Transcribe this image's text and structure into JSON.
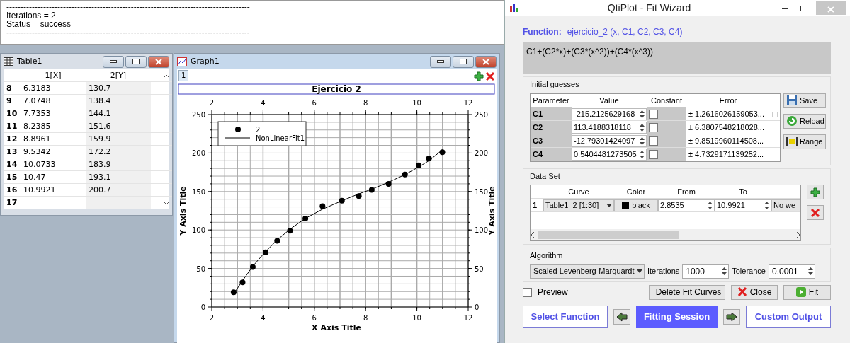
{
  "log": {
    "lines": [
      "--------------------------------------------------------------------------------------",
      "Iterations = 2",
      "Status = success",
      "--------------------------------------------------------------------------------------"
    ]
  },
  "table_window": {
    "title": "Table1",
    "columns": [
      "1[X]",
      "2[Y]"
    ],
    "rows": [
      {
        "index": "8",
        "cells": [
          "6.3183",
          "130.7"
        ]
      },
      {
        "index": "9",
        "cells": [
          "7.0748",
          "138.4"
        ]
      },
      {
        "index": "10",
        "cells": [
          "7.7353",
          "144.1"
        ]
      },
      {
        "index": "11",
        "cells": [
          "8.2385",
          "151.6"
        ]
      },
      {
        "index": "12",
        "cells": [
          "8.8961",
          "159.9"
        ]
      },
      {
        "index": "13",
        "cells": [
          "9.5342",
          "172.2"
        ]
      },
      {
        "index": "14",
        "cells": [
          "10.0733",
          "183.9"
        ]
      },
      {
        "index": "15",
        "cells": [
          "10.47",
          "193.1"
        ]
      },
      {
        "index": "16",
        "cells": [
          "10.9921",
          "200.7"
        ]
      },
      {
        "index": "17",
        "cells": []
      }
    ]
  },
  "graph_window": {
    "title": "Graph1",
    "layer_tab": "1",
    "chart_data": {
      "type": "scatter",
      "title": "Ejercicio 2",
      "xlabel": "X Axis Title",
      "ylabel": "Y Axis Title",
      "y2label": "Y Axis Title",
      "x": [
        2.8535,
        3.2,
        3.6,
        4.1,
        4.55,
        5.05,
        5.65,
        6.3183,
        7.0748,
        7.7353,
        8.2385,
        8.8961,
        9.5342,
        10.0733,
        10.47,
        10.9921
      ],
      "series": [
        {
          "name": "2",
          "type": "scatter",
          "values": [
            19,
            32,
            52,
            71,
            86,
            99,
            115,
            131,
            138,
            144,
            152,
            160,
            172,
            184,
            193,
            201
          ]
        },
        {
          "name": "NonLinearFit1",
          "type": "line",
          "values": [
            17,
            34,
            53,
            72,
            87,
            101,
            115,
            127,
            138,
            147,
            153,
            162,
            172,
            182,
            190,
            204
          ]
        }
      ],
      "xlim": [
        2,
        12
      ],
      "ylim": [
        0,
        250
      ],
      "xticks": [
        2,
        4,
        6,
        8,
        10,
        12
      ],
      "yticks": [
        0,
        50,
        100,
        150,
        200,
        250
      ],
      "x2lim": [
        2,
        12
      ],
      "y2lim": [
        0,
        250
      ],
      "x2ticks": [
        2,
        4,
        6,
        8,
        10,
        12
      ],
      "y2ticks": [
        0,
        50,
        100,
        150,
        200,
        250
      ],
      "grid": true,
      "legend": true
    }
  },
  "fit_wizard": {
    "title": "QtiPlot - Fit Wizard",
    "function_label": "Function:",
    "function_name": "ejercicio_2 (x, C1, C2, C3, C4)",
    "formula": "C1+(C2*x)+(C3*(x^2))+(C4*(x^3))",
    "initial_guesses": {
      "title": "Initial guesses",
      "columns": [
        "Parameter",
        "Value",
        "Constant",
        "Error"
      ],
      "rows": [
        {
          "parameter": "C1",
          "value": "-215.2125629168",
          "constant": false,
          "error": "± 1.2616026159053..."
        },
        {
          "parameter": "C2",
          "value": "113.4188318118",
          "constant": false,
          "error": "± 6.3807548218028..."
        },
        {
          "parameter": "C3",
          "value": "-12.79301424097",
          "constant": false,
          "error": "± 9.8519960114508..."
        },
        {
          "parameter": "C4",
          "value": "0.5404481273505",
          "constant": false,
          "error": "± 4.7329171139252..."
        }
      ]
    },
    "side_buttons": [
      {
        "label": "Save",
        "kind": "save"
      },
      {
        "label": "Reload",
        "kind": "reload"
      },
      {
        "label": "Range",
        "kind": "range"
      }
    ],
    "data_set": {
      "title": "Data Set",
      "columns": [
        "Curve",
        "Color",
        "From",
        "To"
      ],
      "rows": [
        {
          "index": "1",
          "curve": "Table1_2 [1:30]",
          "color": "#000000",
          "color_name": "black",
          "from": "2.8535",
          "to": "10.9921",
          "column_5": "No we"
        }
      ]
    },
    "algorithm": {
      "title": "Algorithm",
      "method": "Scaled Levenberg-Marquardt",
      "iterations_label": "Iterations",
      "iterations": "1000",
      "tolerance_label": "Tolerance",
      "tolerance": "0.0001"
    },
    "preview": {
      "label": "Preview",
      "checked": false
    },
    "action_buttons": [
      {
        "label": "Delete Fit Curves",
        "kind": "delete"
      },
      {
        "label": "Close",
        "kind": "close"
      },
      {
        "label": "Fit",
        "kind": "fit"
      }
    ],
    "pages": [
      {
        "label": "Select Function",
        "selected": false
      },
      {
        "label": "Fitting Session",
        "selected": true
      },
      {
        "label": "Custom Output",
        "selected": false
      }
    ]
  }
}
